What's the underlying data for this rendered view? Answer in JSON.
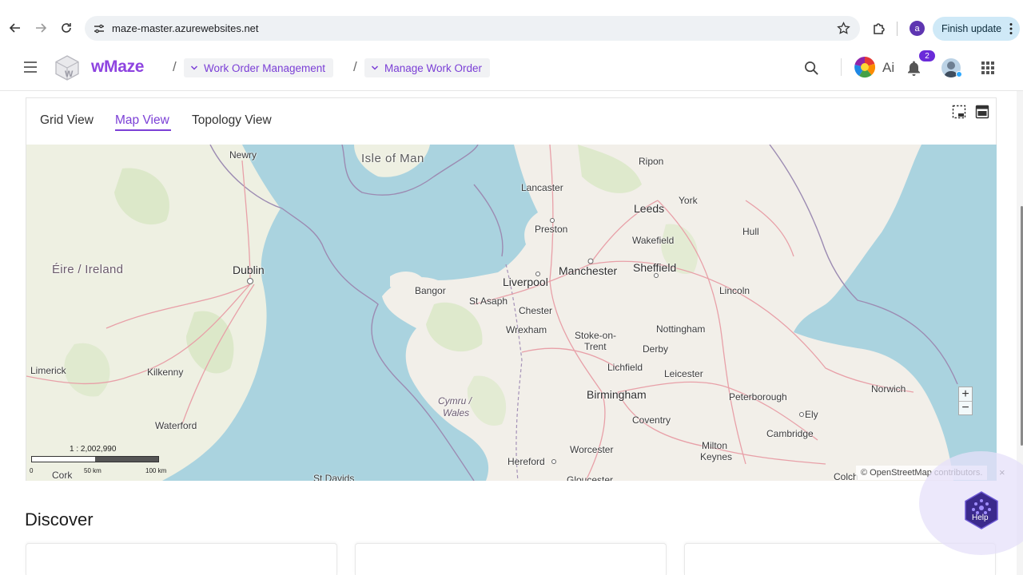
{
  "browser": {
    "url": "maze-master.azurewebsites.net",
    "profile_initial": "a",
    "update_label": "Finish update"
  },
  "header": {
    "brand": "wMaze",
    "breadcrumbs": [
      {
        "label": "Work Order Management"
      },
      {
        "label": "Manage Work Order"
      }
    ],
    "separator": "/",
    "ai_label": "Ai",
    "notification_count": "2"
  },
  "views": {
    "tabs": [
      {
        "label": "Grid View",
        "active": false
      },
      {
        "label": "Map View",
        "active": true
      },
      {
        "label": "Topology View",
        "active": false
      }
    ]
  },
  "map": {
    "places": {
      "newry": "Newry",
      "isle_of_man": "Isle of Man",
      "ripon": "Ripon",
      "lancaster": "Lancaster",
      "york": "York",
      "leeds": "Leeds",
      "preston": "Preston",
      "hull": "Hull",
      "wakefield": "Wakefield",
      "eire": "Éire / Ireland",
      "dublin": "Dublin",
      "manchester": "Manchester",
      "sheffield": "Sheffield",
      "liverpool": "Liverpool",
      "bangor": "Bangor",
      "st_asaph": "St Asaph",
      "lincoln": "Lincoln",
      "chester": "Chester",
      "wrexham": "Wrexham",
      "nottingham": "Nottingham",
      "stoke": "Stoke-on-",
      "trent": "Trent",
      "derby": "Derby",
      "limerick": "Limerick",
      "kilkenny": "Kilkenny",
      "lichfield": "Lichfield",
      "leicester": "Leicester",
      "cymru": "Cymru /",
      "wales": "Wales",
      "birmingham": "Birmingham",
      "norwich": "Norwich",
      "peterborough": "Peterborough",
      "ely": "Ely",
      "waterford": "Waterford",
      "coventry": "Coventry",
      "cambridge": "Cambridge",
      "worcester": "Worcester",
      "milton": "Milton",
      "keynes": "Keynes",
      "cork": "Cork",
      "hereford": "Hereford",
      "st_davids": "St Davids",
      "gloucester": "Gloucester",
      "colchester": "Colch"
    },
    "scale_ratio": "1 : 2,002,990",
    "scale_ticks": [
      "0",
      "50 km",
      "100 km"
    ],
    "attribution": "© OpenStreetMap contributors.",
    "attribution_close": "×",
    "zoom_in": "+",
    "zoom_out": "−"
  },
  "discover": {
    "title": "Discover"
  },
  "help": {
    "label": "Help"
  },
  "colors": {
    "accent": "#7b3fd6",
    "brand": "#8e44e0",
    "sea": "#aad3df",
    "land": "#f2efe9"
  },
  "icons": {
    "back": "back-arrow-icon",
    "forward": "forward-arrow-icon",
    "reload": "reload-icon",
    "site_settings": "tune-icon",
    "bookmark": "star-icon",
    "extensions": "puzzle-icon",
    "menu": "hamburger-icon",
    "search": "search-icon",
    "notifications": "bell-icon",
    "apps": "grid-icon"
  }
}
